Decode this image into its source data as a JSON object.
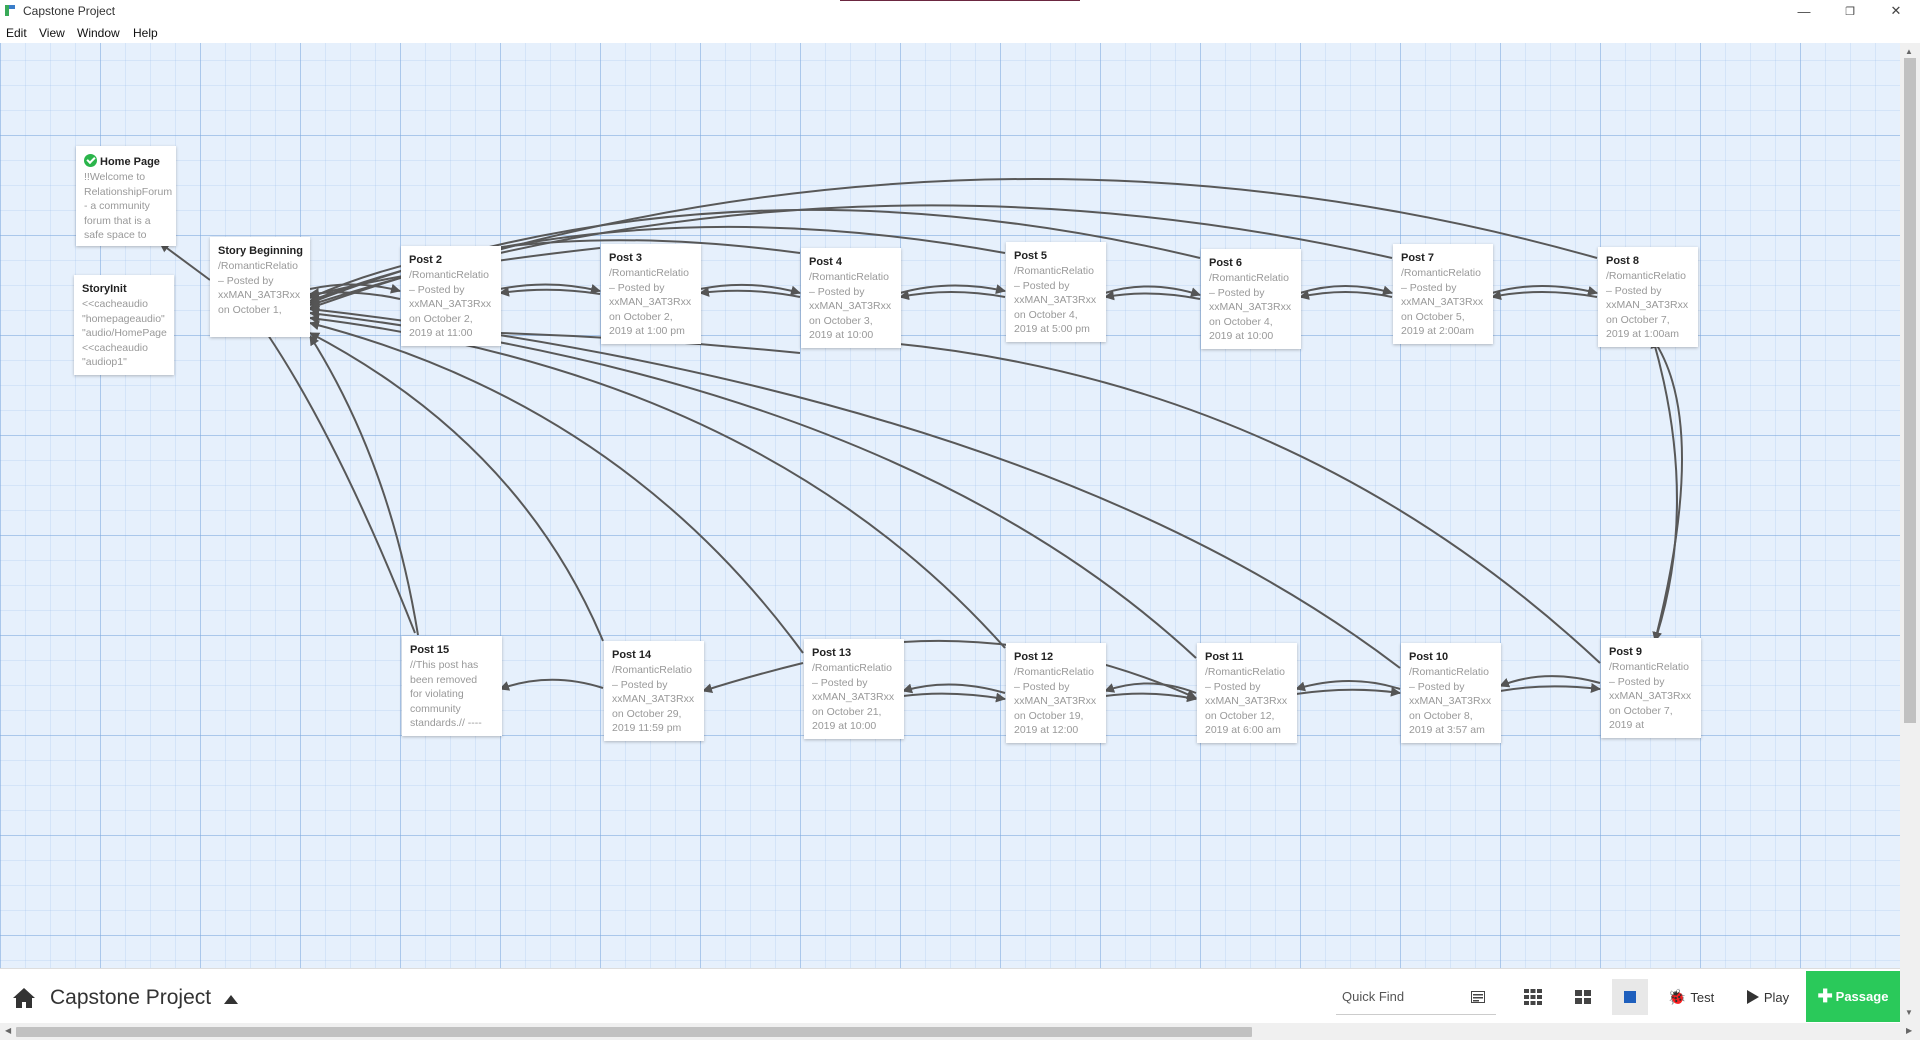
{
  "window": {
    "title": "Capstone Project",
    "minimize": "—",
    "restore": "❐",
    "close": "✕"
  },
  "menu": [
    "Edit",
    "View",
    "Window",
    "Help"
  ],
  "passages": [
    {
      "id": "home",
      "name": "Home Page",
      "start": true,
      "excerpt": "!!Welcome to\nRelationshipForum\n- a community\nforum that is a\nsafe space to"
    },
    {
      "id": "storyinit",
      "name": "StoryInit",
      "excerpt": "<<cacheaudio\n\"homepageaudio\"\n\"audio/HomePage\n<<cacheaudio\n\"audiop1\""
    },
    {
      "id": "story",
      "name": "Story Beginning",
      "excerpt": "/RomanticRelatio\n– Posted by\nxxMAN_3AT3Rxx\non October 1,"
    },
    {
      "id": "p2",
      "name": "Post 2",
      "excerpt": "/RomanticRelatio\n– Posted by\nxxMAN_3AT3Rxx\non October 2,\n2019 at 11:00"
    },
    {
      "id": "p3",
      "name": "Post 3",
      "excerpt": "/RomanticRelatio\n– Posted by\nxxMAN_3AT3Rxx\non October 2,\n2019 at 1:00 pm"
    },
    {
      "id": "p4",
      "name": "Post 4",
      "excerpt": "/RomanticRelatio\n– Posted by\nxxMAN_3AT3Rxx\non October 3,\n2019 at 10:00"
    },
    {
      "id": "p5",
      "name": "Post 5",
      "excerpt": "/RomanticRelatio\n– Posted by\nxxMAN_3AT3Rxx\non October 4,\n2019 at 5:00 pm"
    },
    {
      "id": "p6",
      "name": "Post 6",
      "excerpt": "/RomanticRelatio\n– Posted by\nxxMAN_3AT3Rxx\non October 4,\n2019 at 10:00"
    },
    {
      "id": "p7",
      "name": "Post 7",
      "excerpt": "/RomanticRelatio\n– Posted by\nxxMAN_3AT3Rxx\non October 5,\n2019 at 2:00am"
    },
    {
      "id": "p8",
      "name": "Post 8",
      "excerpt": "/RomanticRelatio\n– Posted by\nxxMAN_3AT3Rxx\non October 7,\n2019 at 1:00am"
    },
    {
      "id": "p9",
      "name": "Post 9",
      "excerpt": "/RomanticRelatio\n– Posted by\nxxMAN_3AT3Rxx\non October 7,\n2019 at"
    },
    {
      "id": "p10",
      "name": "Post 10",
      "excerpt": "/RomanticRelatio\n– Posted by\nxxMAN_3AT3Rxx\non October 8,\n2019 at 3:57 am"
    },
    {
      "id": "p11",
      "name": "Post 11",
      "excerpt": "/RomanticRelatio\n– Posted by\nxxMAN_3AT3Rxx\non October 12,\n2019 at 6:00 am"
    },
    {
      "id": "p12",
      "name": "Post 12",
      "excerpt": "/RomanticRelatio\n– Posted by\nxxMAN_3AT3Rxx\non October 19,\n2019 at 12:00"
    },
    {
      "id": "p13",
      "name": "Post 13",
      "excerpt": "/RomanticRelatio\n– Posted by\nxxMAN_3AT3Rxx\non October 21,\n2019 at 10:00"
    },
    {
      "id": "p14",
      "name": "Post 14",
      "excerpt": "/RomanticRelatio\n– Posted by\nxxMAN_3AT3Rxx\non October 29,\n2019 11:59 pm"
    },
    {
      "id": "p15",
      "name": "Post 15",
      "excerpt": "//This post has\nbeen removed\nfor violating\ncommunity\nstandards.// ----"
    }
  ],
  "toolbar": {
    "story_title": "Capstone Project",
    "quick_find_placeholder": "Quick Find",
    "test_label": "Test",
    "play_label": "Play",
    "passage_label": "Passage",
    "accent": "#2ac95a"
  }
}
